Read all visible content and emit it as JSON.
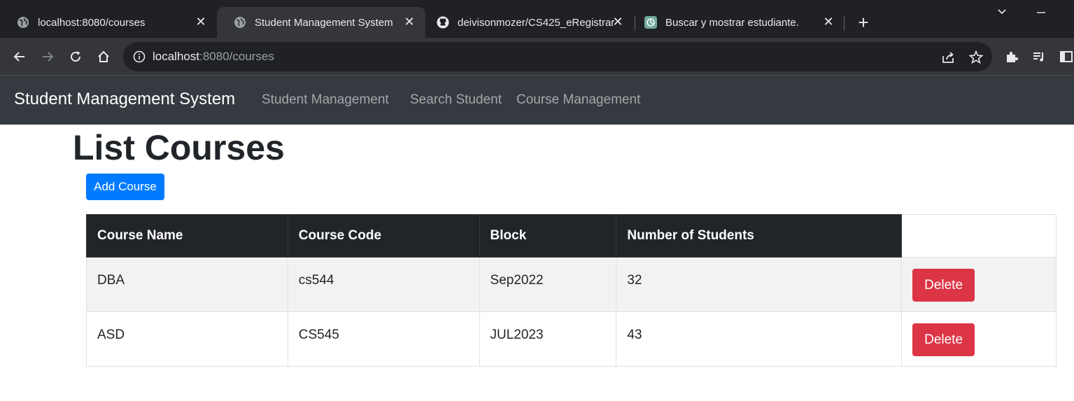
{
  "browser": {
    "tabs": [
      {
        "title": "localhost:8080/courses",
        "active": false,
        "favicon": "globe-icon"
      },
      {
        "title": "Student Management System",
        "active": true,
        "favicon": "globe-icon"
      },
      {
        "title": "deivisonmozer/CS425_eRegistrar",
        "active": false,
        "favicon": "github-icon"
      },
      {
        "title": "Buscar y mostrar estudiante.",
        "active": false,
        "favicon": "chatgpt-icon"
      }
    ],
    "address": {
      "host": "localhost",
      "path": ":8080/courses"
    }
  },
  "navbar": {
    "brand": "Student Management System",
    "links": [
      "Student Management",
      "Search Student",
      "Course Management"
    ]
  },
  "page": {
    "title": "List Courses",
    "add_button": "Add Course"
  },
  "table": {
    "headers": [
      "Course Name",
      "Course Code",
      "Block",
      "Number of Students"
    ],
    "rows": [
      {
        "name": "DBA",
        "code": "cs544",
        "block": "Sep2022",
        "students": "32",
        "action": "Delete"
      },
      {
        "name": "ASD",
        "code": "CS545",
        "block": "JUL2023",
        "students": "43",
        "action": "Delete"
      }
    ]
  },
  "colors": {
    "navbar_bg": "#343a40",
    "primary": "#007bff",
    "danger": "#dc3545",
    "table_head": "#212529"
  }
}
